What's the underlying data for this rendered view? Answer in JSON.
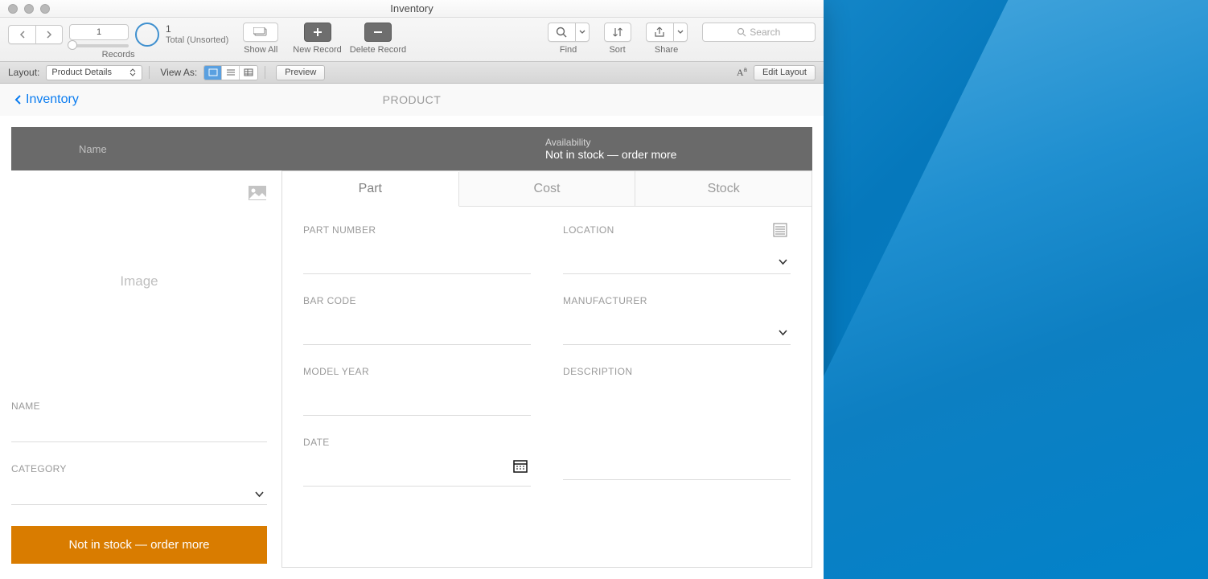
{
  "window": {
    "title": "Inventory"
  },
  "toolbar": {
    "record_position": "1",
    "record_count": "1",
    "sort_state": "Total (Unsorted)",
    "labels": {
      "records": "Records",
      "show_all": "Show All",
      "new_record": "New Record",
      "delete_record": "Delete Record",
      "find": "Find",
      "sort": "Sort",
      "share": "Share"
    },
    "search_placeholder": "Search"
  },
  "layoutbar": {
    "layout_label": "Layout:",
    "layout_name": "Product Details",
    "view_as_label": "View As:",
    "preview_label": "Preview",
    "edit_layout_label": "Edit Layout"
  },
  "breadcrumb": {
    "back_label": "Inventory",
    "page_title": "PRODUCT"
  },
  "header_band": {
    "name_label": "Name",
    "availability_label": "Availability",
    "availability_value": "Not in stock — order more"
  },
  "left_panel": {
    "image_placeholder": "Image",
    "name_label": "NAME",
    "category_label": "CATEGORY",
    "stock_status": "Not in stock — order more"
  },
  "tabs": [
    "Part",
    "Cost",
    "Stock"
  ],
  "form": {
    "part_number": "PART NUMBER",
    "location": "LOCATION",
    "bar_code": "BAR CODE",
    "manufacturer": "MANUFACTURER",
    "model_year": "MODEL YEAR",
    "description": "DESCRIPTION",
    "date": "DATE"
  }
}
